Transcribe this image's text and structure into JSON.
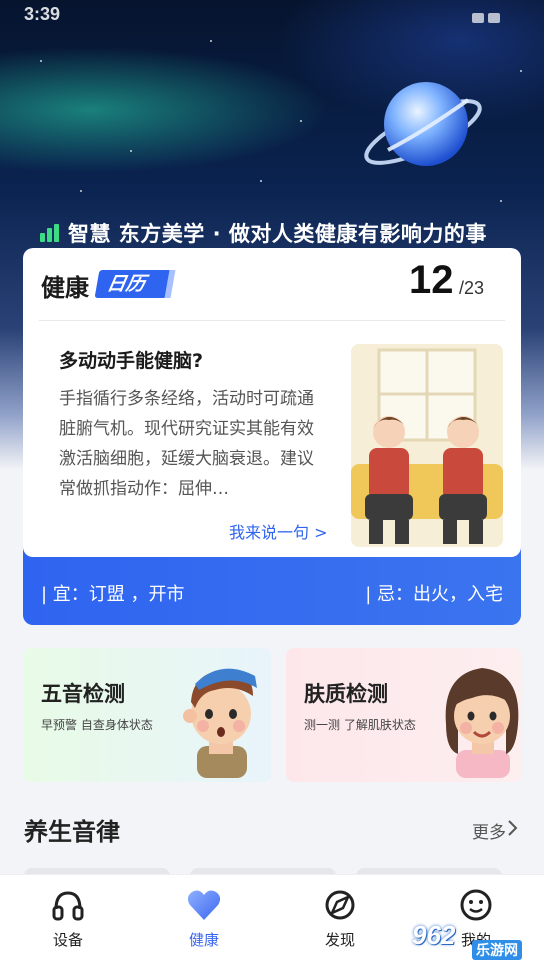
{
  "status_bar": {
    "time": "3:39"
  },
  "hero": {
    "slogan": "智慧 东方美学 · 做对人类健康有影响力的事"
  },
  "calendar": {
    "title": "健康",
    "tag": "日历",
    "day": "12",
    "month": "/23",
    "article_title": "多动动手能健脑?",
    "article_body": "手指循行多条经络，活动时可疏通脏腑气机。现代研究证实其能有效激活脑细胞，延缓大脑衰退。建议常做抓指动作：屈伸…",
    "comment_link": "我来说一句 >",
    "yi": "| 宜：订盟 ，开市",
    "ji": "| 忌：出火，入宅"
  },
  "detect": {
    "wuyin": {
      "title": "五音检测",
      "subtitle": "早预警 自查身体状态"
    },
    "fuzhi": {
      "title": "肤质检测",
      "subtitle": "测一测 了解肌肤状态"
    }
  },
  "section": {
    "title": "养生音律",
    "more": "更多"
  },
  "nav": {
    "items": [
      {
        "label": "设备",
        "icon": "headphones-icon"
      },
      {
        "label": "健康",
        "icon": "heart-icon",
        "active": true
      },
      {
        "label": "发现",
        "icon": "compass-icon"
      },
      {
        "label": "我的",
        "icon": "smile-icon"
      }
    ]
  },
  "watermark": {
    "text": "962",
    "sub": "乐游网"
  },
  "colors": {
    "accent": "#2f64f0",
    "nav_active": "#3b67f0",
    "signal": "#3ddc84"
  }
}
